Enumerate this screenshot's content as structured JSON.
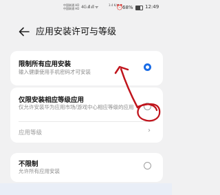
{
  "status_bar": {
    "carrier_line1": "中国联通 HD",
    "carrier_line2": "中国联通 HD",
    "signal": "4G ᵢıll ᵢıll ᯤ",
    "net_speed": "3.4 K/s",
    "alarm_icon": "alarm-icon",
    "battery_pct": "68%",
    "time": "12:49"
  },
  "header": {
    "back_icon": "back-arrow-icon",
    "title": "应用安装许可与等级"
  },
  "options": [
    {
      "title": "限制所有应用安装",
      "subtitle": "输入健康使用手机密码才可安装",
      "selected": true
    },
    {
      "title": "仅限安装相应等级应用",
      "subtitle": "仅允许安装华为应用市场/游戏中心相应等级的应用",
      "selected": false,
      "sub_row": "应用等级"
    },
    {
      "title": "不限制",
      "subtitle": "允许所有应用安装",
      "selected": false
    }
  ],
  "colors": {
    "accent": "#1a6ce6",
    "annotation": "#c0141c",
    "background": "#f1f1f2"
  }
}
